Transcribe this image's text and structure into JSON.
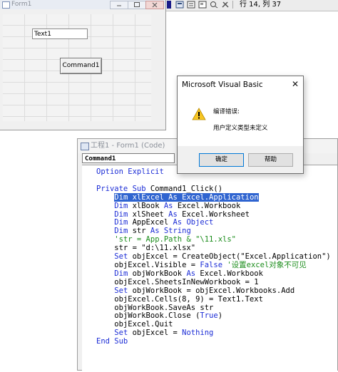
{
  "toolbar": {
    "status": "行 14, 列 37"
  },
  "form_window": {
    "title": "Form1",
    "textbox_value": "Text1",
    "command_label": "Command1"
  },
  "code_window": {
    "title": "工程1 - Form1 (Code)",
    "object_combo": "Command1",
    "lines": [
      [
        {
          "t": "Option Explicit",
          "c": "kw"
        }
      ],
      [],
      [
        {
          "t": "Private Sub",
          "c": "kw"
        },
        {
          "t": " Command1_Click()"
        }
      ],
      [
        {
          "t": "    "
        },
        {
          "t": "Dim xlExcel As Excel.Application",
          "c": "sel"
        }
      ],
      [
        {
          "t": "    "
        },
        {
          "t": "Dim",
          "c": "kw"
        },
        {
          "t": " xlBook "
        },
        {
          "t": "As",
          "c": "kw"
        },
        {
          "t": " Excel.Workbook"
        }
      ],
      [
        {
          "t": "    "
        },
        {
          "t": "Dim",
          "c": "kw"
        },
        {
          "t": " xlSheet "
        },
        {
          "t": "As",
          "c": "kw"
        },
        {
          "t": " Excel.Worksheet"
        }
      ],
      [
        {
          "t": "    "
        },
        {
          "t": "Dim",
          "c": "kw"
        },
        {
          "t": " AppExcel "
        },
        {
          "t": "As Object",
          "c": "kw"
        }
      ],
      [
        {
          "t": "    "
        },
        {
          "t": "Dim",
          "c": "kw"
        },
        {
          "t": " str "
        },
        {
          "t": "As String",
          "c": "kw"
        }
      ],
      [
        {
          "t": "    "
        },
        {
          "t": "'str = App.Path & \"\\11.xls\"",
          "c": "cm"
        }
      ],
      [
        {
          "t": "    str = \"d:\\11.xlsx\""
        }
      ],
      [
        {
          "t": "    "
        },
        {
          "t": "Set",
          "c": "kw"
        },
        {
          "t": " objExcel = CreateObject(\"Excel.Application\")"
        }
      ],
      [
        {
          "t": "    objExcel.Visible = "
        },
        {
          "t": "False",
          "c": "kw"
        },
        {
          "t": " "
        },
        {
          "t": "'设置excel对象不可见",
          "c": "cm"
        }
      ],
      [
        {
          "t": "    "
        },
        {
          "t": "Dim",
          "c": "kw"
        },
        {
          "t": " objWorkBook "
        },
        {
          "t": "As",
          "c": "kw"
        },
        {
          "t": " Excel.Workbook"
        }
      ],
      [
        {
          "t": "    objExcel.SheetsInNewWorkbook = 1"
        }
      ],
      [
        {
          "t": "    "
        },
        {
          "t": "Set",
          "c": "kw"
        },
        {
          "t": " objWorkBook = objExcel.Workbooks.Add"
        }
      ],
      [
        {
          "t": "    objExcel.Cells(8, 9) = Text1.Text"
        }
      ],
      [
        {
          "t": "    objWorkBook.SaveAs str"
        }
      ],
      [
        {
          "t": "    objWorkBook.Close ("
        },
        {
          "t": "True",
          "c": "kw"
        },
        {
          "t": ")"
        }
      ],
      [
        {
          "t": "    objExcel.Quit"
        }
      ],
      [
        {
          "t": "    "
        },
        {
          "t": "Set",
          "c": "kw"
        },
        {
          "t": " objExcel = "
        },
        {
          "t": "Nothing",
          "c": "kw"
        }
      ],
      [
        {
          "t": "End Sub",
          "c": "kw"
        }
      ]
    ]
  },
  "message_box": {
    "title": "Microsoft Visual Basic",
    "close_label": "✕",
    "line1": "编译错误:",
    "line2": "用户定义类型未定义",
    "ok_label": "确定",
    "help_label": "帮助",
    "icon": "warning-icon"
  },
  "colors": {
    "keyword": "#1c2dd6",
    "comment": "#1a8c1a",
    "selection": "#2f64d0"
  }
}
